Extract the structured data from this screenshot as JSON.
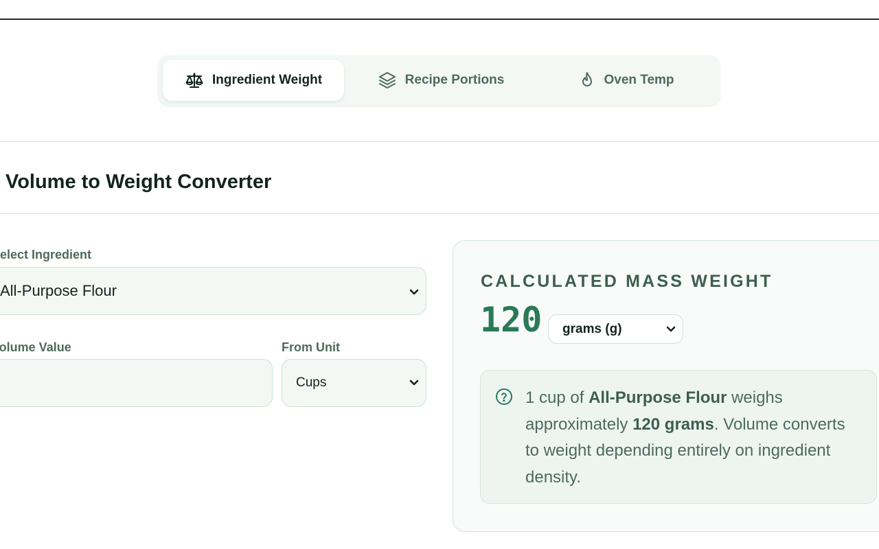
{
  "tabs": [
    {
      "label": "Ingredient Weight",
      "icon": "scale-icon",
      "active": true
    },
    {
      "label": "Recipe Portions",
      "icon": "layers-icon",
      "active": false
    },
    {
      "label": "Oven Temp",
      "icon": "flame-icon",
      "active": false
    }
  ],
  "converter": {
    "title": "Volume to Weight Converter",
    "ingredient_label": "Select Ingredient",
    "ingredient_value": "All-Purpose Flour",
    "volume_label": "Volume Value",
    "volume_value": "",
    "from_unit_label": "From Unit",
    "from_unit_value": "Cups"
  },
  "result": {
    "heading": "CALCULATED MASS WEIGHT",
    "value": "120",
    "unit": "grams (g)",
    "info": {
      "prefix": "1 cup of ",
      "ingredient": "All-Purpose Flour",
      "middle": " weighs approximately ",
      "amount": "120 grams",
      "suffix": ". Volume converts to weight depending entirely on ingredient density."
    }
  },
  "colors": {
    "accent": "#2a7a58",
    "panel_bg": "#f3f8f5",
    "border": "#cfe2d8",
    "text_dark": "#13241c",
    "text_muted": "#4d6b5c"
  }
}
